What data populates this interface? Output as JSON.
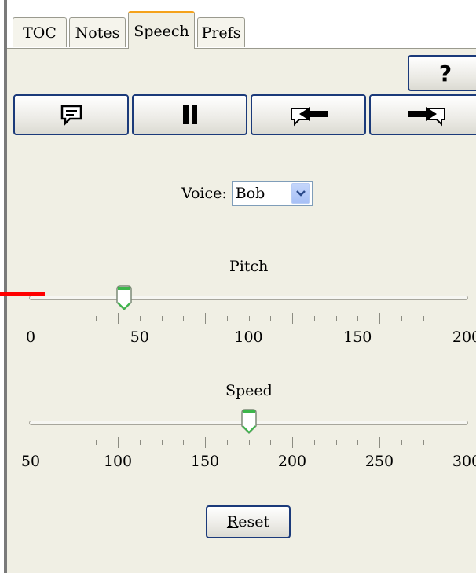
{
  "tabs": [
    {
      "label": "TOC",
      "active": false
    },
    {
      "label": "Notes",
      "active": false
    },
    {
      "label": "Speech",
      "active": true
    },
    {
      "label": "Prefs",
      "active": false
    }
  ],
  "help_label": "?",
  "toolbar": {
    "speak_icon": "speech-bubble-icon",
    "pause_icon": "pause-icon",
    "previous_icon": "arrow-left-bubble-icon",
    "next_icon": "arrow-right-bubble-icon"
  },
  "voice": {
    "label": "Voice:",
    "value": "Bob"
  },
  "pitch": {
    "label": "Pitch",
    "min": 0,
    "max": 200,
    "value": 43,
    "ticks": [
      "0",
      "50",
      "100",
      "150",
      "200"
    ]
  },
  "speed": {
    "label": "Speed",
    "min": 50,
    "max": 300,
    "value": 175,
    "ticks": [
      "50",
      "100",
      "150",
      "200",
      "250",
      "300"
    ]
  },
  "reset_label": "Reset",
  "colors": {
    "accent_tab": "#f4a21a",
    "button_border": "#1b3a7a",
    "panel": "#f0efe4",
    "thumb_green": "#3cb64a"
  }
}
